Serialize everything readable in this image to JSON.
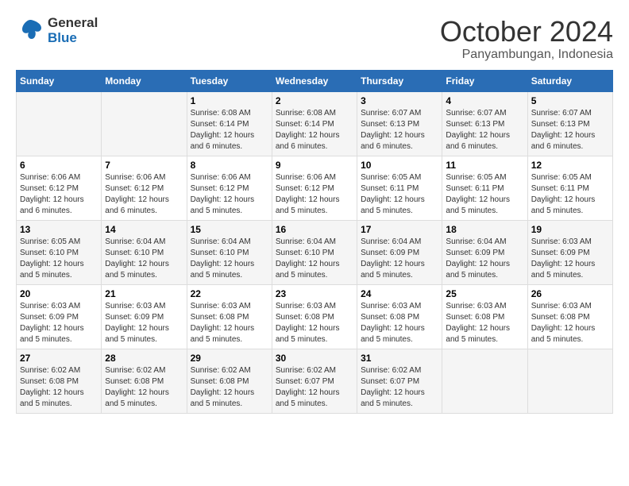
{
  "logo": {
    "line1": "General",
    "line2": "Blue"
  },
  "title": "October 2024",
  "subtitle": "Panyambungan, Indonesia",
  "days_header": [
    "Sunday",
    "Monday",
    "Tuesday",
    "Wednesday",
    "Thursday",
    "Friday",
    "Saturday"
  ],
  "weeks": [
    [
      {
        "num": "",
        "detail": ""
      },
      {
        "num": "",
        "detail": ""
      },
      {
        "num": "1",
        "detail": "Sunrise: 6:08 AM\nSunset: 6:14 PM\nDaylight: 12 hours\nand 6 minutes."
      },
      {
        "num": "2",
        "detail": "Sunrise: 6:08 AM\nSunset: 6:14 PM\nDaylight: 12 hours\nand 6 minutes."
      },
      {
        "num": "3",
        "detail": "Sunrise: 6:07 AM\nSunset: 6:13 PM\nDaylight: 12 hours\nand 6 minutes."
      },
      {
        "num": "4",
        "detail": "Sunrise: 6:07 AM\nSunset: 6:13 PM\nDaylight: 12 hours\nand 6 minutes."
      },
      {
        "num": "5",
        "detail": "Sunrise: 6:07 AM\nSunset: 6:13 PM\nDaylight: 12 hours\nand 6 minutes."
      }
    ],
    [
      {
        "num": "6",
        "detail": "Sunrise: 6:06 AM\nSunset: 6:12 PM\nDaylight: 12 hours\nand 6 minutes."
      },
      {
        "num": "7",
        "detail": "Sunrise: 6:06 AM\nSunset: 6:12 PM\nDaylight: 12 hours\nand 6 minutes."
      },
      {
        "num": "8",
        "detail": "Sunrise: 6:06 AM\nSunset: 6:12 PM\nDaylight: 12 hours\nand 5 minutes."
      },
      {
        "num": "9",
        "detail": "Sunrise: 6:06 AM\nSunset: 6:12 PM\nDaylight: 12 hours\nand 5 minutes."
      },
      {
        "num": "10",
        "detail": "Sunrise: 6:05 AM\nSunset: 6:11 PM\nDaylight: 12 hours\nand 5 minutes."
      },
      {
        "num": "11",
        "detail": "Sunrise: 6:05 AM\nSunset: 6:11 PM\nDaylight: 12 hours\nand 5 minutes."
      },
      {
        "num": "12",
        "detail": "Sunrise: 6:05 AM\nSunset: 6:11 PM\nDaylight: 12 hours\nand 5 minutes."
      }
    ],
    [
      {
        "num": "13",
        "detail": "Sunrise: 6:05 AM\nSunset: 6:10 PM\nDaylight: 12 hours\nand 5 minutes."
      },
      {
        "num": "14",
        "detail": "Sunrise: 6:04 AM\nSunset: 6:10 PM\nDaylight: 12 hours\nand 5 minutes."
      },
      {
        "num": "15",
        "detail": "Sunrise: 6:04 AM\nSunset: 6:10 PM\nDaylight: 12 hours\nand 5 minutes."
      },
      {
        "num": "16",
        "detail": "Sunrise: 6:04 AM\nSunset: 6:10 PM\nDaylight: 12 hours\nand 5 minutes."
      },
      {
        "num": "17",
        "detail": "Sunrise: 6:04 AM\nSunset: 6:09 PM\nDaylight: 12 hours\nand 5 minutes."
      },
      {
        "num": "18",
        "detail": "Sunrise: 6:04 AM\nSunset: 6:09 PM\nDaylight: 12 hours\nand 5 minutes."
      },
      {
        "num": "19",
        "detail": "Sunrise: 6:03 AM\nSunset: 6:09 PM\nDaylight: 12 hours\nand 5 minutes."
      }
    ],
    [
      {
        "num": "20",
        "detail": "Sunrise: 6:03 AM\nSunset: 6:09 PM\nDaylight: 12 hours\nand 5 minutes."
      },
      {
        "num": "21",
        "detail": "Sunrise: 6:03 AM\nSunset: 6:09 PM\nDaylight: 12 hours\nand 5 minutes."
      },
      {
        "num": "22",
        "detail": "Sunrise: 6:03 AM\nSunset: 6:08 PM\nDaylight: 12 hours\nand 5 minutes."
      },
      {
        "num": "23",
        "detail": "Sunrise: 6:03 AM\nSunset: 6:08 PM\nDaylight: 12 hours\nand 5 minutes."
      },
      {
        "num": "24",
        "detail": "Sunrise: 6:03 AM\nSunset: 6:08 PM\nDaylight: 12 hours\nand 5 minutes."
      },
      {
        "num": "25",
        "detail": "Sunrise: 6:03 AM\nSunset: 6:08 PM\nDaylight: 12 hours\nand 5 minutes."
      },
      {
        "num": "26",
        "detail": "Sunrise: 6:03 AM\nSunset: 6:08 PM\nDaylight: 12 hours\nand 5 minutes."
      }
    ],
    [
      {
        "num": "27",
        "detail": "Sunrise: 6:02 AM\nSunset: 6:08 PM\nDaylight: 12 hours\nand 5 minutes."
      },
      {
        "num": "28",
        "detail": "Sunrise: 6:02 AM\nSunset: 6:08 PM\nDaylight: 12 hours\nand 5 minutes."
      },
      {
        "num": "29",
        "detail": "Sunrise: 6:02 AM\nSunset: 6:08 PM\nDaylight: 12 hours\nand 5 minutes."
      },
      {
        "num": "30",
        "detail": "Sunrise: 6:02 AM\nSunset: 6:07 PM\nDaylight: 12 hours\nand 5 minutes."
      },
      {
        "num": "31",
        "detail": "Sunrise: 6:02 AM\nSunset: 6:07 PM\nDaylight: 12 hours\nand 5 minutes."
      },
      {
        "num": "",
        "detail": ""
      },
      {
        "num": "",
        "detail": ""
      }
    ]
  ]
}
